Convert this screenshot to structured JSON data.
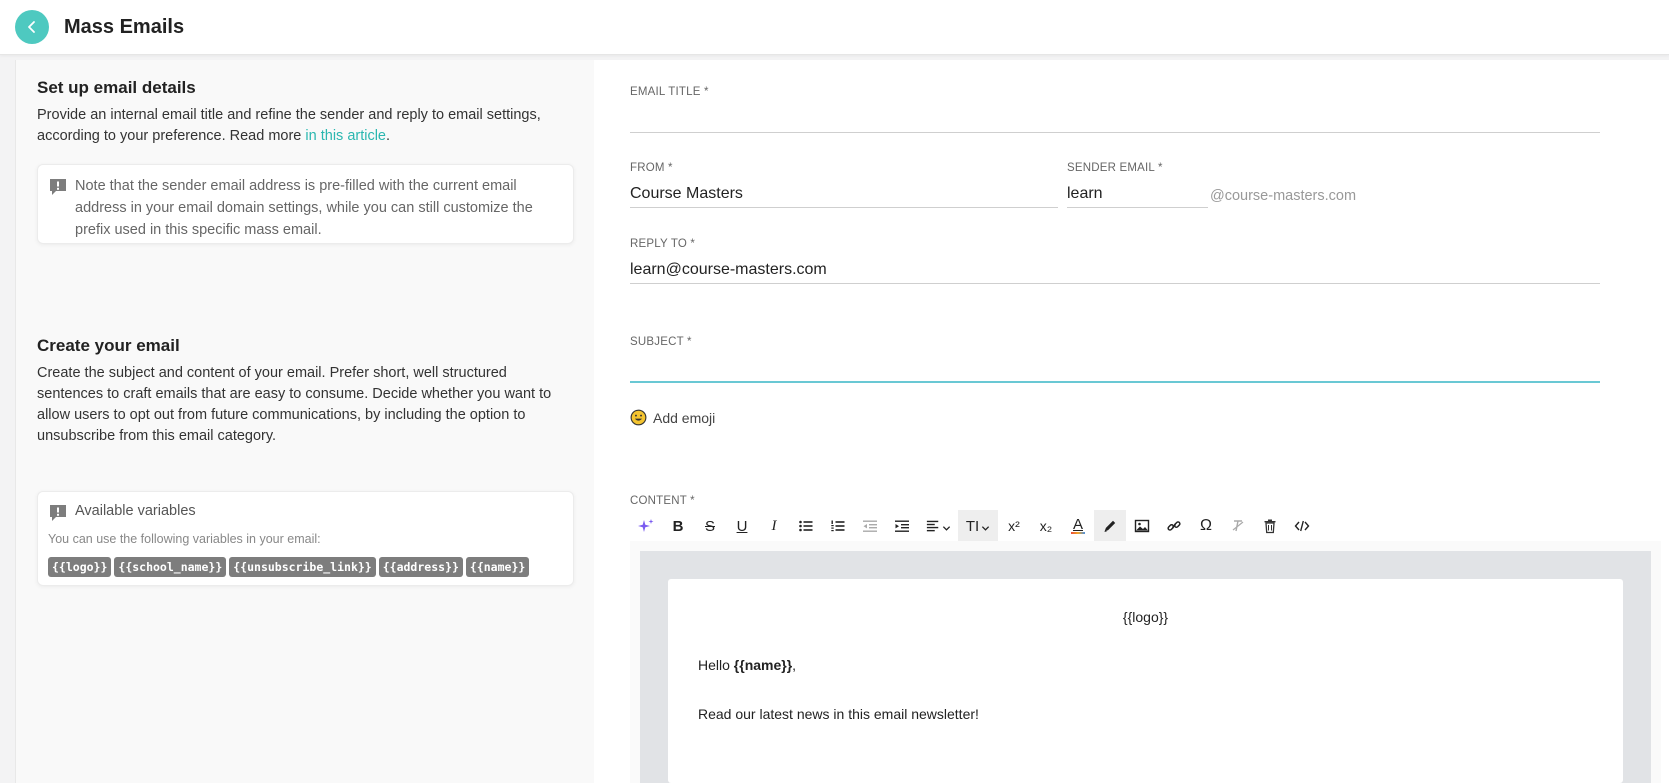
{
  "header": {
    "title": "Mass Emails"
  },
  "colors": {
    "accent": "#4ec9c0",
    "link": "#2bb7b0",
    "focus_underline": "#69c8d4"
  },
  "setup": {
    "title": "Set up email details",
    "description_before": "Provide an internal email title and refine the sender and reply to email settings, according to your preference. Read more ",
    "link_text": "in this article",
    "description_after": ".",
    "note": "Note that the sender email address is pre-filled with the current email address in your email domain settings, while you can still customize the prefix used in this specific mass email."
  },
  "create": {
    "title": "Create your email",
    "description": "Create the subject and content of your email. Prefer short, well structured sentences to craft emails that are easy to consume. Decide whether you want to allow users to opt out from future communications, by including the option to unsubscribe from this email category."
  },
  "variables": {
    "title": "Available variables",
    "subtitle": "You can use the following variables in your email:",
    "chips": [
      "{{logo}}",
      "{{school_name}}",
      "{{unsubscribe_link}}",
      "{{address}}",
      "{{name}}"
    ]
  },
  "form": {
    "email_title_label": "EMAIL TITLE *",
    "email_title_value": "",
    "from_label": "FROM *",
    "from_value": "Course Masters",
    "sender_email_label": "SENDER EMAIL *",
    "sender_email_value": "learn",
    "sender_domain": "@course-masters.com",
    "reply_to_label": "REPLY TO *",
    "reply_to_value": "learn@course-masters.com",
    "subject_label": "SUBJECT *",
    "subject_value": "",
    "add_emoji_label": "Add emoji",
    "content_label": "CONTENT *"
  },
  "editor": {
    "logo_var": "{{logo}}",
    "hello_text": "Hello ",
    "hello_var": "{{name}}",
    "hello_suffix": ",",
    "news_text": "Read our latest news in this email newsletter!"
  },
  "toolbar": {
    "bold": "B",
    "strike": "S",
    "underline": "U",
    "italic": "I",
    "text_size": "TΙ",
    "superscript": "x²",
    "subscript": "x₂",
    "font_color": "A",
    "special_char": "Ω"
  }
}
